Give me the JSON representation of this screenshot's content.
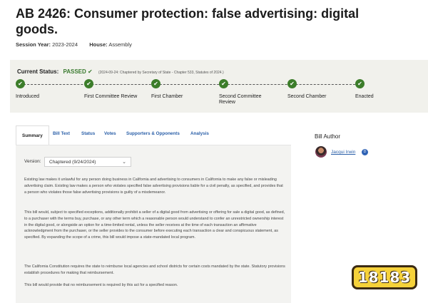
{
  "bill": {
    "title": "AB 2426: Consumer protection: false advertising: digital goods.",
    "session_label": "Session Year:",
    "session_value": "2023-2024",
    "house_label": "House:",
    "house_value": "Assembly"
  },
  "status": {
    "label": "Current Status:",
    "value": "PASSED",
    "check_icon": "✔",
    "detail": "(2024-09-24: Chaptered by Secretary of State - Chapter 533, Statutes of 2024.)",
    "steps": [
      {
        "label": "Introduced"
      },
      {
        "label": "First Committee Review"
      },
      {
        "label": "First Chamber"
      },
      {
        "label": "Second Committee Review"
      },
      {
        "label": "Second Chamber"
      },
      {
        "label": "Enacted"
      }
    ],
    "step_color": "#3c7d2a"
  },
  "tabs": [
    "Summary",
    "Bill Text",
    "Status",
    "Votes",
    "Supporters & Opponents",
    "Analysis"
  ],
  "version": {
    "label": "Version:",
    "selected": "Chaptered (9/24/2024)"
  },
  "summary": [
    "Existing law makes it unlawful for any person doing business in California and advertising to consumers in California to make any false or misleading advertising claim. Existing law makes a person who violates specified false advertising provisions liable for a civil penalty, as specified, and provides that a person who violates those false advertising provisions is guilty of a misdemeanor.",
    "This bill would, subject to specified exceptions, additionally prohibit a seller of a digital good from advertising or offering for sale a digital good, as defined, to a purchaser with the terms buy, purchase, or any other term which a reasonable person would understand to confer an unrestricted ownership interest in the digital good, or alongside an option for a time-limited rental, unless the seller receives at the time of each transaction an affirmative acknowledgment from the purchaser, or the seller provides to the consumer before executing each transaction a clear and conspicuous statement, as specified. By expanding the scope of a crime, this bill would impose a state-mandated local program.",
    "The California Constitution requires the state to reimburse local agencies and school districts for certain costs mandated by the state. Statutory provisions establish procedures for making that reimbursement.",
    "This bill would provide that no reimbursement is required by this act for a specified reason."
  ],
  "author": {
    "heading": "Bill Author",
    "name": "Jacqui Irwin",
    "party": "D"
  },
  "watermark": "18183"
}
